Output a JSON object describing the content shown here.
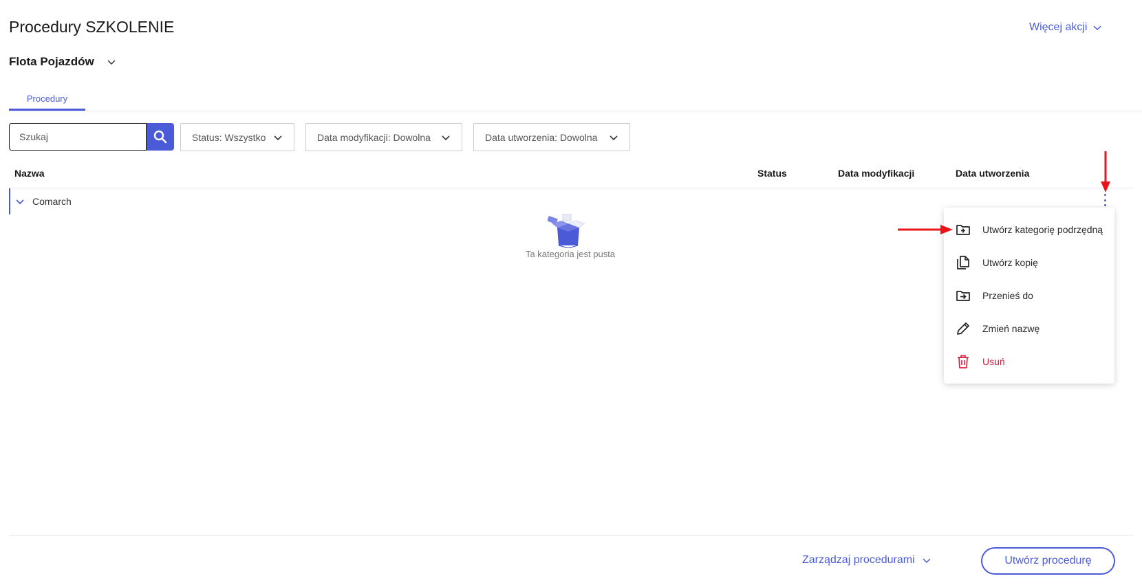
{
  "header": {
    "title": "Procedury SZKOLENIE",
    "more_actions_label": "Więcej akcji"
  },
  "module_selector": {
    "label": "Flota Pojazdów"
  },
  "tabs": [
    {
      "label": "Procedury",
      "active": true
    }
  ],
  "search": {
    "placeholder": "Szukaj",
    "value": ""
  },
  "filters": [
    {
      "label": "Status: Wszystko"
    },
    {
      "label": "Data modyfikacji: Dowolna"
    },
    {
      "label": "Data utworzenia: Dowolna"
    }
  ],
  "table": {
    "columns": [
      "Nazwa",
      "Status",
      "Data modyfikacji",
      "Data utworzenia"
    ],
    "rows": [
      {
        "name": "Comarch",
        "expanded": true
      }
    ],
    "empty_text": "Ta kategoria jest pusta"
  },
  "context_menu": {
    "items": [
      {
        "label": "Utwórz kategorię podrzędną",
        "icon": "create-folder-icon"
      },
      {
        "label": "Utwórz kopię",
        "icon": "copy-icon"
      },
      {
        "label": "Przenieś do",
        "icon": "move-folder-icon"
      },
      {
        "label": "Zmień nazwę",
        "icon": "pencil-icon"
      },
      {
        "label": "Usuń",
        "icon": "trash-icon",
        "danger": true
      }
    ]
  },
  "footer": {
    "manage_label": "Zarządzaj procedurami",
    "create_label": "Utwórz procedurę"
  },
  "colors": {
    "accent": "#4b5bd8",
    "danger": "#d81e3d",
    "annotation_arrow": "#e8141a"
  }
}
